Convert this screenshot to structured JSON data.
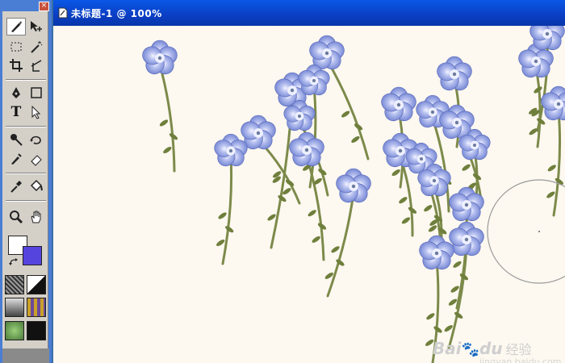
{
  "window": {
    "title": "未标题-1 @ 100%"
  },
  "toolbox": {
    "close_label": "×",
    "tools": [
      {
        "name": "brush-tool",
        "selected": true
      },
      {
        "name": "move-tool"
      },
      {
        "name": "marquee-tool"
      },
      {
        "name": "magic-wand-tool"
      },
      {
        "name": "crop-tool"
      },
      {
        "name": "slice-tool"
      },
      {
        "name": "pen-tool"
      },
      {
        "name": "rectangle-tool"
      },
      {
        "name": "type-tool",
        "label": "T"
      },
      {
        "name": "path-select-tool"
      },
      {
        "name": "healing-tool"
      },
      {
        "name": "history-brush-tool"
      },
      {
        "name": "art-brush-tool"
      },
      {
        "name": "eraser-tool"
      },
      {
        "name": "eyedropper-tool"
      },
      {
        "name": "paint-bucket-tool"
      },
      {
        "name": "zoom-tool"
      },
      {
        "name": "hand-tool"
      }
    ],
    "foreground_color": "#ffffff",
    "background_color": "#5544dd"
  },
  "watermark": {
    "brand": "Bai",
    "brand2": "du",
    "cn": "经验",
    "url": "jingyan.baidu.com"
  },
  "colors": {
    "canvas_bg": "#fdf8f0",
    "title_bg": "#0a4ed8",
    "petal": "#8e9ce0",
    "stem": "#7a8a50"
  }
}
